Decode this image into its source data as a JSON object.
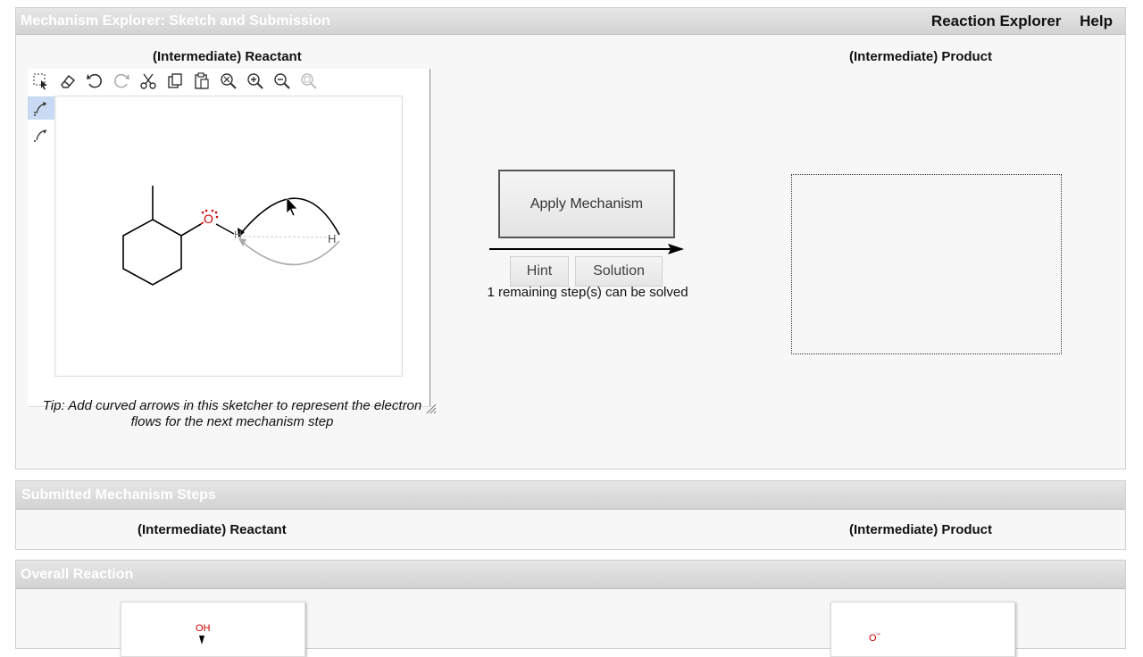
{
  "header": {
    "title": "Mechanism Explorer: Sketch and Submission",
    "links": [
      "Reaction Explorer",
      "Help"
    ]
  },
  "sketch": {
    "reactant_title": "(Intermediate) Reactant",
    "product_title": "(Intermediate) Product",
    "toolbar_icons": [
      "marquee-select-icon",
      "eraser-icon",
      "undo-icon",
      "redo-icon",
      "cut-icon",
      "copy-icon",
      "paste-icon",
      "zoom-fit-icon",
      "zoom-in-icon",
      "zoom-out-icon",
      "zoom-reset-icon"
    ],
    "sidebar_icons": [
      "curved-arrow-pair-icon",
      "curved-arrow-single-icon"
    ],
    "atom_labels": {
      "oxygen": "O",
      "hydrogen_left": "H",
      "hydrogen_right": "H"
    },
    "tip": "Tip: Add curved arrows in this sketcher to represent the electron flows for the next mechanism step",
    "apply_label": "Apply Mechanism",
    "hint_label": "Hint",
    "solution_label": "Solution",
    "remaining_note": "1 remaining step(s) can be solved"
  },
  "submitted": {
    "title": "Submitted Mechanism Steps",
    "reactant_title": "(Intermediate) Reactant",
    "product_title": "(Intermediate) Product"
  },
  "overall": {
    "title": "Overall Reaction",
    "reactant_label": "OH",
    "product_label": "O"
  },
  "colors": {
    "accent_red": "#cc0000",
    "header_text": "#ffffff",
    "active_tool": "#c9daf4"
  }
}
